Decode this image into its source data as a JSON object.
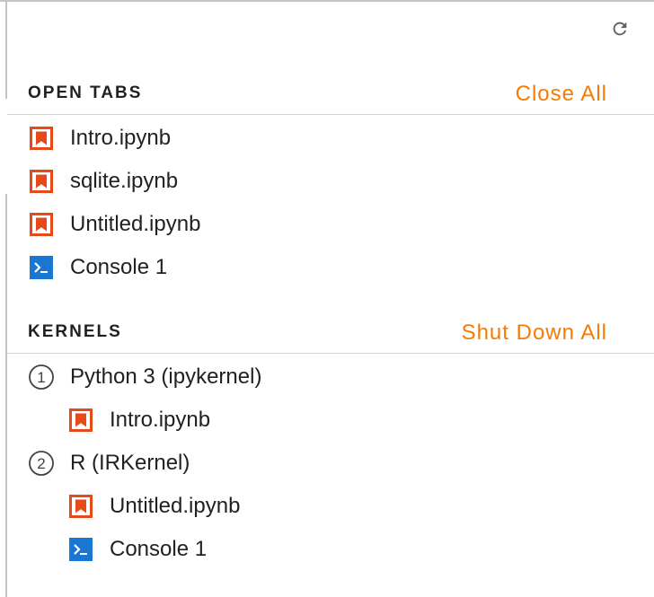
{
  "open_tabs": {
    "title": "OPEN TABS",
    "close_all_label": "Close All",
    "items": [
      {
        "label": "Intro.ipynb",
        "icon": "notebook-icon"
      },
      {
        "label": "sqlite.ipynb",
        "icon": "notebook-icon"
      },
      {
        "label": "Untitled.ipynb",
        "icon": "notebook-icon"
      },
      {
        "label": "Console 1",
        "icon": "console-icon"
      }
    ]
  },
  "kernels": {
    "title": "KERNELS",
    "shut_down_all_label": "Shut Down All",
    "items": [
      {
        "number": "1",
        "label": "Python 3 (ipykernel)",
        "sessions": [
          {
            "label": "Intro.ipynb",
            "icon": "notebook-icon"
          }
        ]
      },
      {
        "number": "2",
        "label": "R (IRKernel)",
        "sessions": [
          {
            "label": "Untitled.ipynb",
            "icon": "notebook-icon"
          },
          {
            "label": "Console 1",
            "icon": "console-icon"
          }
        ]
      }
    ]
  },
  "colors": {
    "accent": "#f57c00",
    "notebook_icon": "#e64a19",
    "console_icon": "#1976d2",
    "text": "#212121",
    "divider": "#d4d4d4"
  },
  "toolbar": {
    "refresh_icon": "refresh-icon"
  }
}
